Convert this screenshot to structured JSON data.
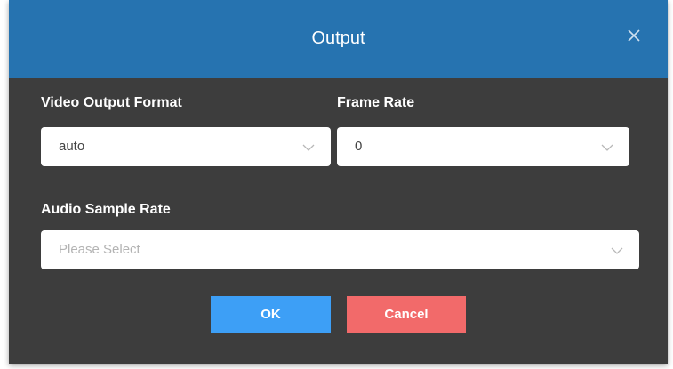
{
  "dialog": {
    "title": "Output",
    "close_icon": "close-icon",
    "header_color": "#2673b0",
    "body_color": "#3d3d3d"
  },
  "fields": {
    "video_output_format": {
      "label": "Video Output Format",
      "value": "auto"
    },
    "frame_rate": {
      "label": "Frame Rate",
      "value": "0"
    },
    "audio_sample_rate": {
      "label": "Audio Sample Rate",
      "placeholder": "Please Select"
    },
    "dropdown_icon": "chevron-down-icon"
  },
  "buttons": {
    "ok_label": "OK",
    "ok_color": "#3d9ff6",
    "cancel_label": "Cancel",
    "cancel_color": "#f26a6a"
  }
}
